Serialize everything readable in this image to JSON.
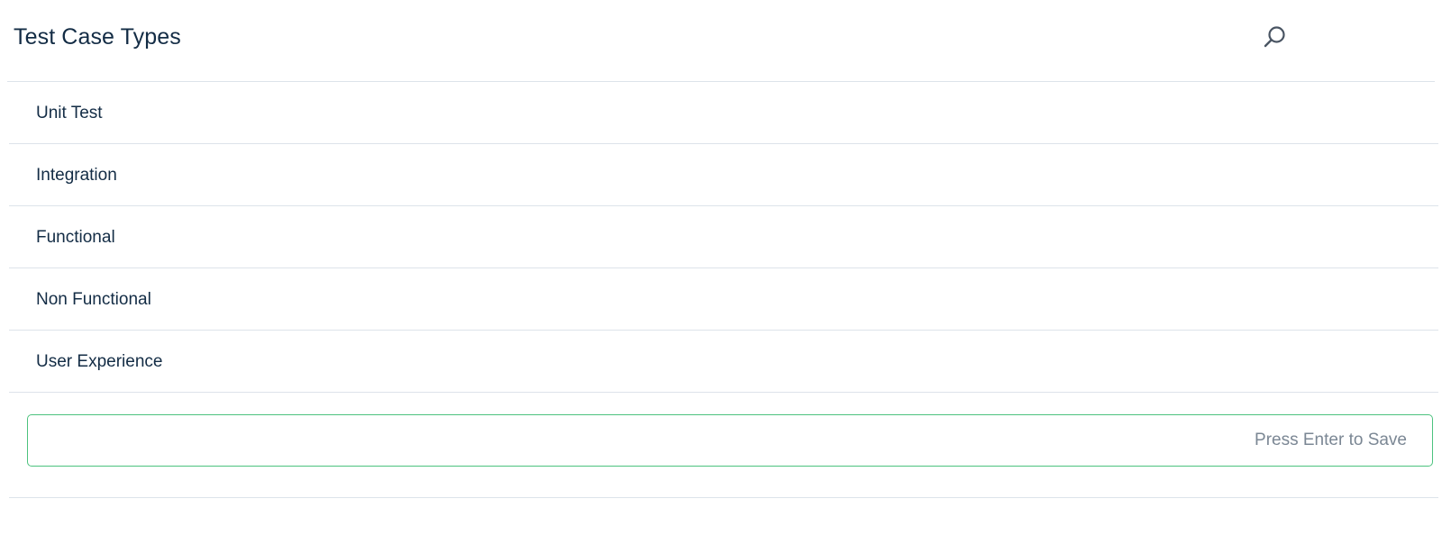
{
  "header": {
    "title": "Test Case Types",
    "search_icon": "search-icon"
  },
  "list": {
    "items": [
      {
        "label": "Unit Test"
      },
      {
        "label": "Integration"
      },
      {
        "label": "Functional"
      },
      {
        "label": "Non Functional"
      },
      {
        "label": "User Experience"
      }
    ]
  },
  "new_item": {
    "value": "",
    "placeholder": "Press Enter to Save"
  },
  "colors": {
    "text": "#132c45",
    "divider": "#dde3ea",
    "input_border": "#4cc27e",
    "placeholder": "#7b8794"
  }
}
